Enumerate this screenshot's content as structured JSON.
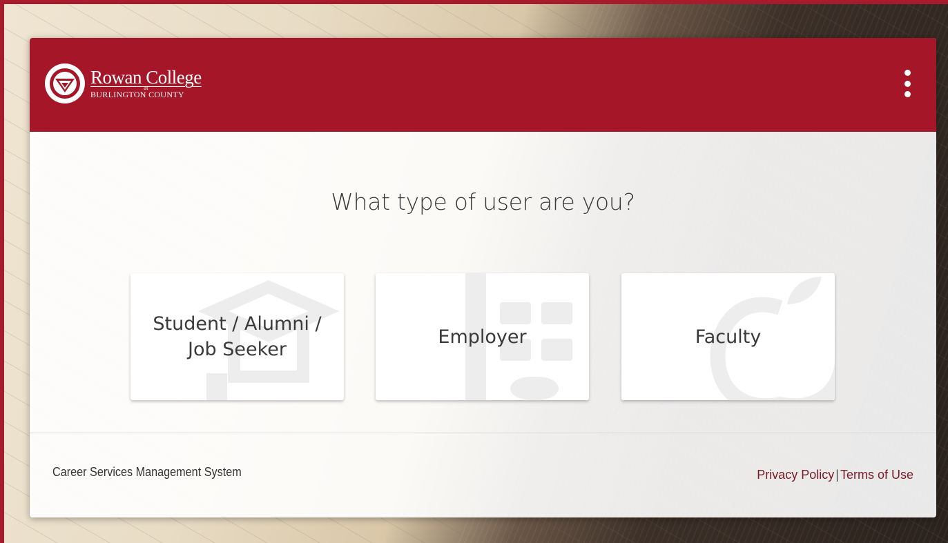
{
  "header": {
    "logo": {
      "name_line1": "Rowan College",
      "name_connector": "at",
      "name_line2": "BURLINGTON COUNTY"
    },
    "menu_icon": "more-vertical-icon",
    "brand_color": "#a51628"
  },
  "main": {
    "question": "What type of user are you?",
    "choices": [
      {
        "label": "Student / Alumni / Job Seeker",
        "watermark_icon": "graduation-cap-icon"
      },
      {
        "label": "Employer",
        "watermark_icon": "building-icon"
      },
      {
        "label": "Faculty",
        "watermark_icon": "apple-icon"
      }
    ]
  },
  "footer": {
    "system_name": "Career Services Management System",
    "privacy_link": "Privacy Policy",
    "separator": "|",
    "terms_link": "Terms of Use"
  }
}
